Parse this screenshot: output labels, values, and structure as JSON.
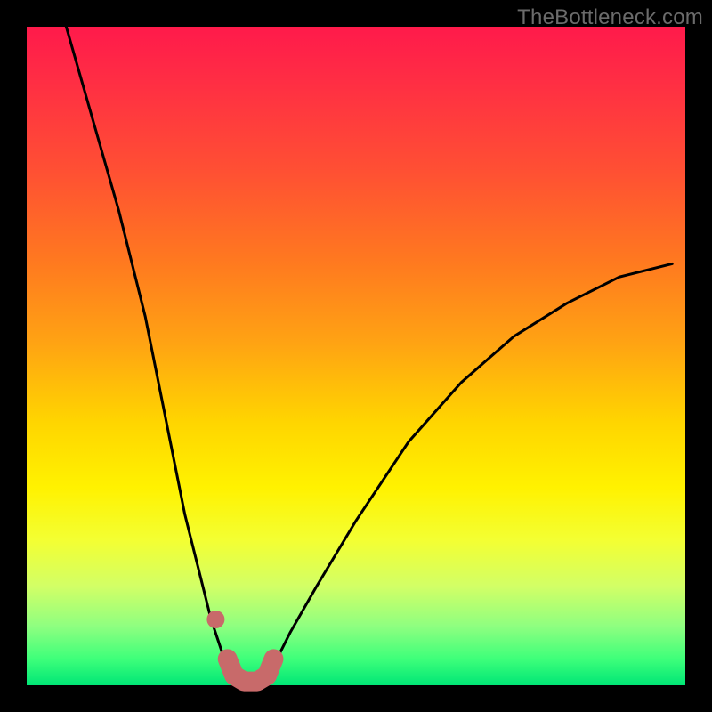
{
  "watermark": {
    "text": "TheBottleneck.com"
  },
  "colors": {
    "curve_stroke": "#000000",
    "marker_stroke": "#c86a6a",
    "marker_fill": "#c86a6a"
  },
  "chart_data": {
    "type": "line",
    "title": "",
    "xlabel": "",
    "ylabel": "",
    "xlim": [
      0,
      100
    ],
    "ylim": [
      0,
      100
    ],
    "grid": false,
    "legend": false,
    "series": [
      {
        "name": "bottleneck-curve",
        "x": [
          6,
          10,
          14,
          18,
          22,
          24,
          26,
          28,
          30,
          31,
          32,
          33,
          34,
          35,
          36,
          38,
          40,
          44,
          50,
          58,
          66,
          74,
          82,
          90,
          98
        ],
        "y": [
          100,
          86,
          72,
          56,
          36,
          26,
          18,
          10,
          4,
          2,
          1,
          0.5,
          0.5,
          1,
          2,
          4,
          8,
          15,
          25,
          37,
          46,
          53,
          58,
          62,
          64
        ]
      }
    ],
    "markers": [
      {
        "name": "left-dot",
        "x": 28.7,
        "y": 10
      },
      {
        "name": "valley-u",
        "type": "segment",
        "path_x": [
          30.5,
          31.5,
          33,
          35,
          36.5,
          37.5
        ],
        "path_y": [
          4,
          1.5,
          0.6,
          0.6,
          1.5,
          4
        ]
      }
    ]
  }
}
